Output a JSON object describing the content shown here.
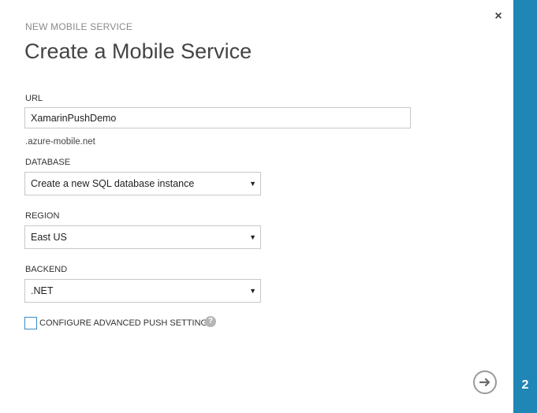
{
  "dialog": {
    "subtitle": "NEW MOBILE SERVICE",
    "title": "Create a Mobile Service",
    "close_glyph": "×",
    "step_number": "2"
  },
  "form": {
    "url": {
      "label": "URL",
      "value": "XamarinPushDemo",
      "suffix": ".azure-mobile.net"
    },
    "database": {
      "label": "DATABASE",
      "selected": "Create a new SQL database instance"
    },
    "region": {
      "label": "REGION",
      "selected": "East US"
    },
    "backend": {
      "label": "BACKEND",
      "selected": ".NET"
    },
    "advanced_push": {
      "label": "CONFIGURE ADVANCED PUSH SETTINGS",
      "checked": false,
      "help_glyph": "?"
    }
  },
  "icons": {
    "close": "close-icon",
    "dropdown": "chevron-down-icon",
    "help": "help-icon",
    "next": "arrow-right-icon"
  },
  "colors": {
    "accent": "#1f86b5",
    "checkbox_border": "#3a8cc4"
  }
}
